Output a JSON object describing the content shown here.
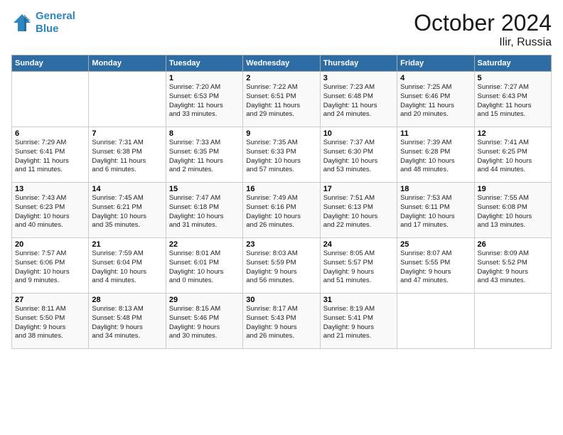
{
  "logo": {
    "line1": "General",
    "line2": "Blue"
  },
  "title": "October 2024",
  "location": "Ilir, Russia",
  "days_header": [
    "Sunday",
    "Monday",
    "Tuesday",
    "Wednesday",
    "Thursday",
    "Friday",
    "Saturday"
  ],
  "weeks": [
    [
      {
        "day": "",
        "sunrise": "",
        "sunset": "",
        "daylight": ""
      },
      {
        "day": "",
        "sunrise": "",
        "sunset": "",
        "daylight": ""
      },
      {
        "day": "1",
        "sunrise": "Sunrise: 7:20 AM",
        "sunset": "Sunset: 6:53 PM",
        "daylight": "Daylight: 11 hours and 33 minutes."
      },
      {
        "day": "2",
        "sunrise": "Sunrise: 7:22 AM",
        "sunset": "Sunset: 6:51 PM",
        "daylight": "Daylight: 11 hours and 29 minutes."
      },
      {
        "day": "3",
        "sunrise": "Sunrise: 7:23 AM",
        "sunset": "Sunset: 6:48 PM",
        "daylight": "Daylight: 11 hours and 24 minutes."
      },
      {
        "day": "4",
        "sunrise": "Sunrise: 7:25 AM",
        "sunset": "Sunset: 6:46 PM",
        "daylight": "Daylight: 11 hours and 20 minutes."
      },
      {
        "day": "5",
        "sunrise": "Sunrise: 7:27 AM",
        "sunset": "Sunset: 6:43 PM",
        "daylight": "Daylight: 11 hours and 15 minutes."
      }
    ],
    [
      {
        "day": "6",
        "sunrise": "Sunrise: 7:29 AM",
        "sunset": "Sunset: 6:41 PM",
        "daylight": "Daylight: 11 hours and 11 minutes."
      },
      {
        "day": "7",
        "sunrise": "Sunrise: 7:31 AM",
        "sunset": "Sunset: 6:38 PM",
        "daylight": "Daylight: 11 hours and 6 minutes."
      },
      {
        "day": "8",
        "sunrise": "Sunrise: 7:33 AM",
        "sunset": "Sunset: 6:35 PM",
        "daylight": "Daylight: 11 hours and 2 minutes."
      },
      {
        "day": "9",
        "sunrise": "Sunrise: 7:35 AM",
        "sunset": "Sunset: 6:33 PM",
        "daylight": "Daylight: 10 hours and 57 minutes."
      },
      {
        "day": "10",
        "sunrise": "Sunrise: 7:37 AM",
        "sunset": "Sunset: 6:30 PM",
        "daylight": "Daylight: 10 hours and 53 minutes."
      },
      {
        "day": "11",
        "sunrise": "Sunrise: 7:39 AM",
        "sunset": "Sunset: 6:28 PM",
        "daylight": "Daylight: 10 hours and 48 minutes."
      },
      {
        "day": "12",
        "sunrise": "Sunrise: 7:41 AM",
        "sunset": "Sunset: 6:25 PM",
        "daylight": "Daylight: 10 hours and 44 minutes."
      }
    ],
    [
      {
        "day": "13",
        "sunrise": "Sunrise: 7:43 AM",
        "sunset": "Sunset: 6:23 PM",
        "daylight": "Daylight: 10 hours and 40 minutes."
      },
      {
        "day": "14",
        "sunrise": "Sunrise: 7:45 AM",
        "sunset": "Sunset: 6:21 PM",
        "daylight": "Daylight: 10 hours and 35 minutes."
      },
      {
        "day": "15",
        "sunrise": "Sunrise: 7:47 AM",
        "sunset": "Sunset: 6:18 PM",
        "daylight": "Daylight: 10 hours and 31 minutes."
      },
      {
        "day": "16",
        "sunrise": "Sunrise: 7:49 AM",
        "sunset": "Sunset: 6:16 PM",
        "daylight": "Daylight: 10 hours and 26 minutes."
      },
      {
        "day": "17",
        "sunrise": "Sunrise: 7:51 AM",
        "sunset": "Sunset: 6:13 PM",
        "daylight": "Daylight: 10 hours and 22 minutes."
      },
      {
        "day": "18",
        "sunrise": "Sunrise: 7:53 AM",
        "sunset": "Sunset: 6:11 PM",
        "daylight": "Daylight: 10 hours and 17 minutes."
      },
      {
        "day": "19",
        "sunrise": "Sunrise: 7:55 AM",
        "sunset": "Sunset: 6:08 PM",
        "daylight": "Daylight: 10 hours and 13 minutes."
      }
    ],
    [
      {
        "day": "20",
        "sunrise": "Sunrise: 7:57 AM",
        "sunset": "Sunset: 6:06 PM",
        "daylight": "Daylight: 10 hours and 9 minutes."
      },
      {
        "day": "21",
        "sunrise": "Sunrise: 7:59 AM",
        "sunset": "Sunset: 6:04 PM",
        "daylight": "Daylight: 10 hours and 4 minutes."
      },
      {
        "day": "22",
        "sunrise": "Sunrise: 8:01 AM",
        "sunset": "Sunset: 6:01 PM",
        "daylight": "Daylight: 10 hours and 0 minutes."
      },
      {
        "day": "23",
        "sunrise": "Sunrise: 8:03 AM",
        "sunset": "Sunset: 5:59 PM",
        "daylight": "Daylight: 9 hours and 56 minutes."
      },
      {
        "day": "24",
        "sunrise": "Sunrise: 8:05 AM",
        "sunset": "Sunset: 5:57 PM",
        "daylight": "Daylight: 9 hours and 51 minutes."
      },
      {
        "day": "25",
        "sunrise": "Sunrise: 8:07 AM",
        "sunset": "Sunset: 5:55 PM",
        "daylight": "Daylight: 9 hours and 47 minutes."
      },
      {
        "day": "26",
        "sunrise": "Sunrise: 8:09 AM",
        "sunset": "Sunset: 5:52 PM",
        "daylight": "Daylight: 9 hours and 43 minutes."
      }
    ],
    [
      {
        "day": "27",
        "sunrise": "Sunrise: 8:11 AM",
        "sunset": "Sunset: 5:50 PM",
        "daylight": "Daylight: 9 hours and 38 minutes."
      },
      {
        "day": "28",
        "sunrise": "Sunrise: 8:13 AM",
        "sunset": "Sunset: 5:48 PM",
        "daylight": "Daylight: 9 hours and 34 minutes."
      },
      {
        "day": "29",
        "sunrise": "Sunrise: 8:15 AM",
        "sunset": "Sunset: 5:46 PM",
        "daylight": "Daylight: 9 hours and 30 minutes."
      },
      {
        "day": "30",
        "sunrise": "Sunrise: 8:17 AM",
        "sunset": "Sunset: 5:43 PM",
        "daylight": "Daylight: 9 hours and 26 minutes."
      },
      {
        "day": "31",
        "sunrise": "Sunrise: 8:19 AM",
        "sunset": "Sunset: 5:41 PM",
        "daylight": "Daylight: 9 hours and 21 minutes."
      },
      {
        "day": "",
        "sunrise": "",
        "sunset": "",
        "daylight": ""
      },
      {
        "day": "",
        "sunrise": "",
        "sunset": "",
        "daylight": ""
      }
    ]
  ]
}
